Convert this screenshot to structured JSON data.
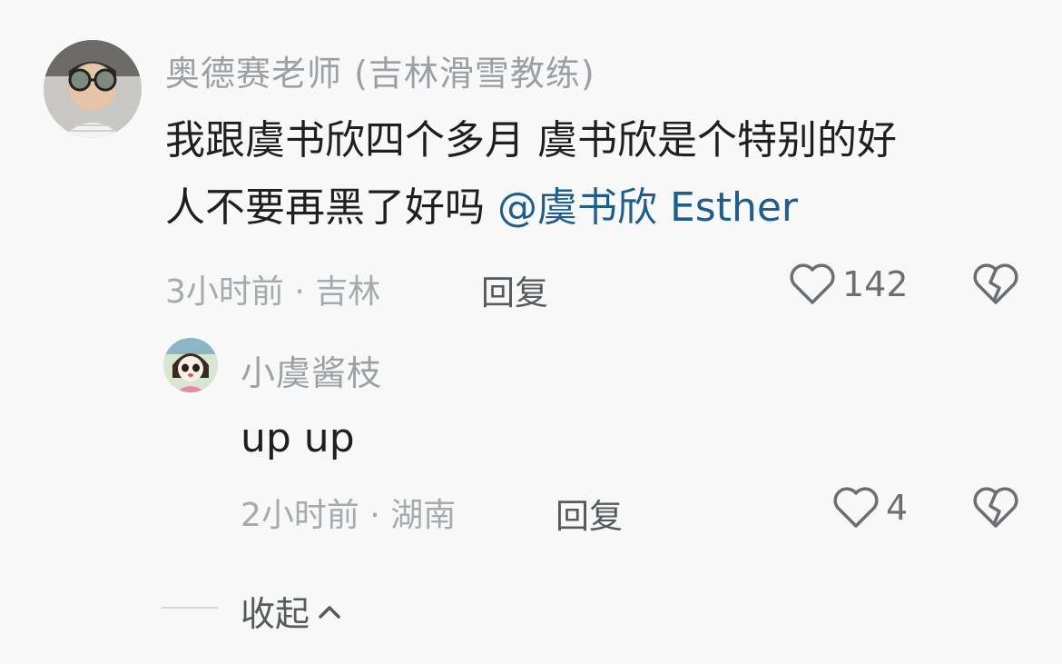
{
  "comment": {
    "author": "奥德赛老师 (吉林滑雪教练)",
    "text_line1": "我跟虞书欣四个多月 虞书欣是个特别的好",
    "text_line2_prefix": "人不要再黑了好吗 ",
    "mention": "@虞书欣 Esther",
    "time": "3小时前",
    "location": "吉林",
    "reply_label": "回复",
    "like_count": "142",
    "icons": {
      "like": "heart-outline-icon",
      "dislike": "broken-heart-icon"
    }
  },
  "reply": {
    "author": "小虞酱枝",
    "text": "up up",
    "time": "2小时前",
    "location": "湖南",
    "reply_label": "回复",
    "like_count": "4",
    "icons": {
      "like": "heart-outline-icon",
      "dislike": "broken-heart-icon"
    }
  },
  "collapse": {
    "label": "收起",
    "icon": "chevron-up-icon"
  },
  "colors": {
    "background": "#f7f8f7",
    "name": "#9aa0a3",
    "mention": "#1f5d8c",
    "meta": "#a5aaad"
  }
}
